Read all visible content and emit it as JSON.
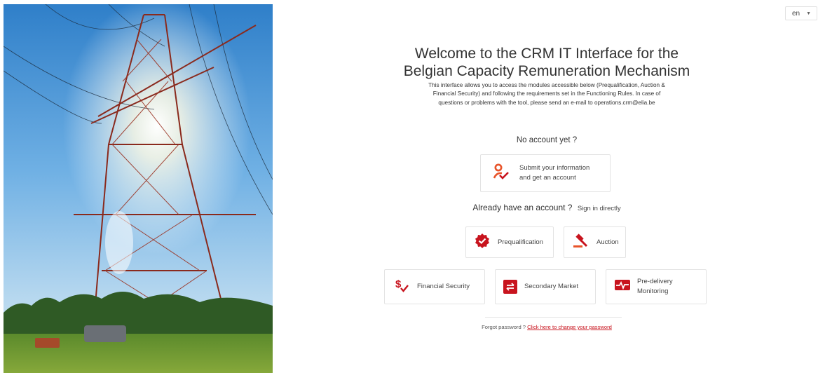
{
  "language": {
    "selected": "en"
  },
  "welcome": {
    "title_line1": "Welcome to the CRM IT Interface for the",
    "title_line2": "Belgian Capacity Remuneration Mechanism",
    "intro_line1": "This interface allows you to access the modules accessible below (Prequalification, Auction &",
    "intro_line2": "Financial Security) and following the requirements set in the Functioning Rules. In case of",
    "intro_line3": "questions or problems with the tool, please send an e-mail to operations.crm@elia.be"
  },
  "signup": {
    "heading": "No account yet ?",
    "card_line1": "Submit your information",
    "card_line2": "and get an account",
    "icon": "user-check-icon"
  },
  "signin": {
    "heading": "Already have an account ?",
    "subheading": "Sign in directly"
  },
  "modules": [
    {
      "label": "Prequalification",
      "icon": "badge-check-icon"
    },
    {
      "label": "Auction",
      "icon": "gavel-icon"
    },
    {
      "label": "Financial Security",
      "icon": "dollar-check-icon"
    },
    {
      "label": "Secondary Market",
      "icon": "exchange-icon"
    },
    {
      "label_line1": "Pre-delivery",
      "label_line2": "Monitoring",
      "icon": "pulse-monitor-icon"
    }
  ],
  "footer": {
    "forgot_text": "Forgot password ?",
    "forgot_link": "Click here to change your password"
  },
  "colors": {
    "accent_red": "#c8141e",
    "accent_orange": "#e8542a"
  }
}
